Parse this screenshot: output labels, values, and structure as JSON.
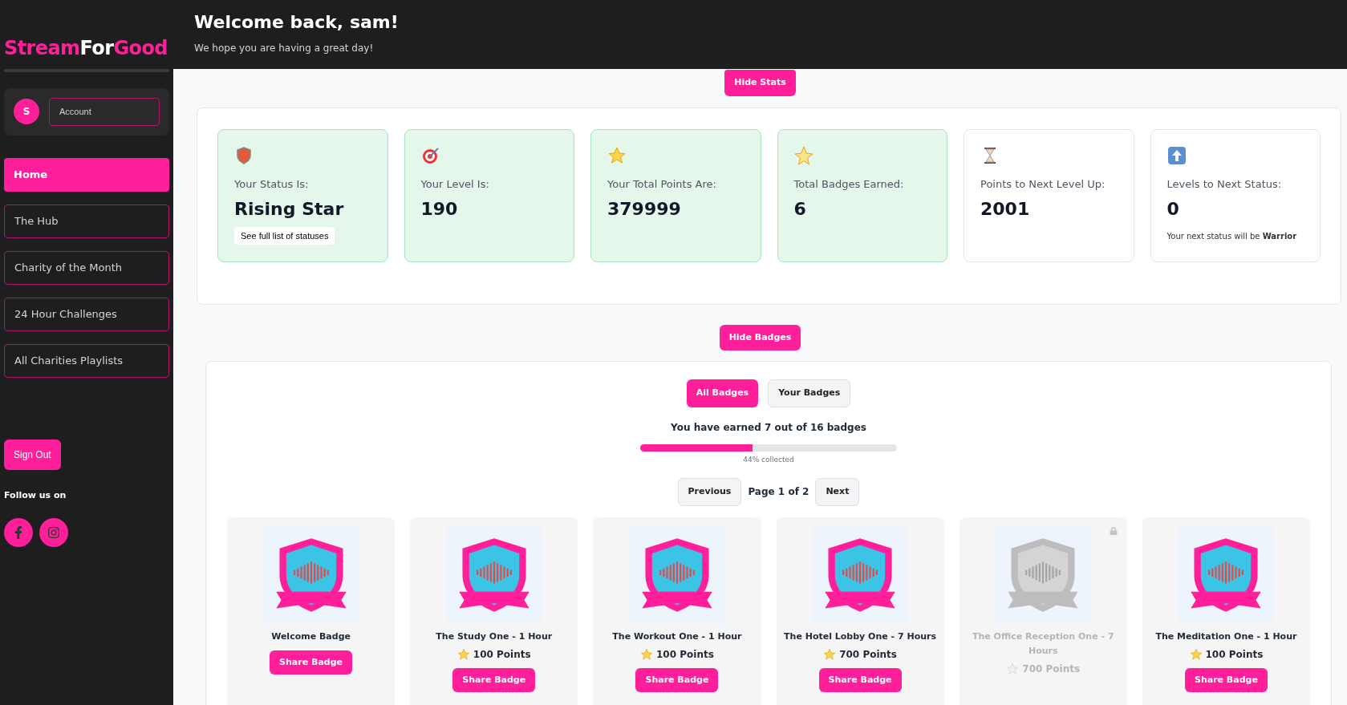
{
  "sidebar": {
    "logo": {
      "part_1": "Stream",
      "part_2": "For",
      "part_3": "Good"
    },
    "avatar_initial": "S",
    "account_button": "Account",
    "items": [
      {
        "label": "Home",
        "selected": true
      },
      {
        "label": "The Hub",
        "selected": false
      },
      {
        "label": "Charity of the Month",
        "selected": false
      },
      {
        "label": "24 Hour Challenges",
        "selected": false
      },
      {
        "label": "All Charities Playlists",
        "selected": false
      }
    ],
    "sign_out": "Sign Out",
    "follow_label": "Follow us on"
  },
  "header": {
    "title": "Welcome back, sam!",
    "subtitle": "We hope you are having a great day!"
  },
  "stats": {
    "toggle": "Hide Stats",
    "cards": [
      {
        "label": "Your Status Is:",
        "value": "Rising Star",
        "highlighted": true,
        "button": "See full list of statuses"
      },
      {
        "label": "Your Level Is:",
        "value": "190",
        "highlighted": true
      },
      {
        "label": "Your Total Points Are:",
        "value": "379999",
        "highlighted": true
      },
      {
        "label": "Total Badges Earned:",
        "value": "6",
        "highlighted": true
      },
      {
        "label": "Points to Next Level Up:",
        "value": "2001",
        "highlighted": false
      },
      {
        "label": "Levels to Next Status:",
        "value": "0",
        "highlighted": false,
        "note": "Your next status will be **Warrior**"
      }
    ]
  },
  "badges": {
    "toggle": "Hide Badges",
    "tabs": [
      {
        "label": "All Badges",
        "selected": true
      },
      {
        "label": "Your Badges",
        "selected": false
      }
    ],
    "progress": {
      "text": "You have earned 7 out of 16 badges",
      "level": 0.4375,
      "caption": "44% collected"
    },
    "pagination": {
      "previous": "Previous",
      "page": "Page 1 of 2",
      "next": "Next"
    },
    "items": [
      {
        "title": "Welcome Badge",
        "earned": true,
        "share": "Share Badge"
      },
      {
        "title": "The Study One - 1 Hour",
        "points": "100 Points",
        "earned": true,
        "share": "Share Badge"
      },
      {
        "title": "The Workout One - 1 Hour",
        "points": "100 Points",
        "earned": true,
        "share": "Share Badge"
      },
      {
        "title": "The Hotel Lobby One - 7 Hours",
        "points": "700 Points",
        "earned": true,
        "share": "Share Badge"
      },
      {
        "title": "The Office Reception One - 7 Hours",
        "points": "700 Points",
        "earned": false
      },
      {
        "title": "The Meditation One - 1 Hour",
        "points": "100 Points",
        "earned": true,
        "share": "Share Badge"
      }
    ]
  }
}
